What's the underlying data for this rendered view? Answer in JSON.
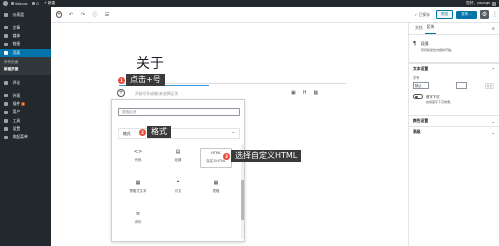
{
  "admin_bar": {
    "site_name": "Sakura",
    "comments_count": "0",
    "new_label": "+ 新建",
    "user_label": "您好，youngs"
  },
  "sidebar": {
    "items": [
      {
        "label": "仪表盘",
        "icon": "dashboard-icon"
      },
      {
        "label": "文章",
        "icon": "pin-icon"
      },
      {
        "label": "媒体",
        "icon": "media-icon"
      },
      {
        "label": "链接",
        "icon": "link-icon"
      },
      {
        "label": "页面",
        "icon": "page-icon",
        "current": true
      }
    ],
    "pages_sub": [
      "所有页面",
      "新建页面"
    ],
    "items_after": [
      {
        "label": "评论",
        "icon": "comment-icon"
      }
    ],
    "items_bottom": [
      {
        "label": "外观",
        "icon": "appearance-icon"
      },
      {
        "label": "插件",
        "icon": "plugin-icon",
        "badge": "2"
      },
      {
        "label": "用户",
        "icon": "user-icon"
      },
      {
        "label": "工具",
        "icon": "tool-icon"
      },
      {
        "label": "设置",
        "icon": "settings-icon"
      },
      {
        "label": "收起菜单",
        "icon": "collapse-icon"
      }
    ]
  },
  "toolbar": {
    "saved_label": "✓ 已保存",
    "preview_label": "预览",
    "publish_label": "发布…"
  },
  "editor": {
    "title": "关于",
    "placeholder": "开始写作或输/来选择区块"
  },
  "annotations": {
    "step1": {
      "num": "1",
      "text": "点击+号"
    },
    "step2": {
      "num": "2",
      "text": "格式"
    },
    "step3": {
      "num": "3",
      "text": "选择自定义HTML"
    }
  },
  "inserter": {
    "search_placeholder": "搜索区块",
    "category": "格式",
    "blocks": [
      {
        "label": "代码",
        "icon": "code-icon",
        "symbol": "<>"
      },
      {
        "label": "经典",
        "icon": "classic-icon",
        "symbol": "▤"
      },
      {
        "label": "自定义HTML",
        "icon": "html-icon",
        "symbol": "HTML"
      },
      {
        "label": "预格式文本",
        "icon": "preformatted-icon",
        "symbol": "▦"
      },
      {
        "label": "引文",
        "icon": "pullquote-icon",
        "symbol": "❝"
      },
      {
        "label": "表格",
        "icon": "table-icon",
        "symbol": "▦"
      },
      {
        "label": "诗句",
        "icon": "verse-icon",
        "symbol": "≡"
      }
    ]
  },
  "settings": {
    "tab_document": "文档",
    "tab_block": "区块",
    "block_name": "段落",
    "block_desc": "所有叙述性内容的开始。",
    "panel_text": "文本设置",
    "font_size_label": "字号",
    "font_size_value": "默认",
    "reset_label": "重置",
    "dropcap_label": "首字下沉",
    "dropcap_help": "启用首字下沉效果。",
    "panel_color": "颜色设置",
    "panel_advanced": "高级"
  }
}
